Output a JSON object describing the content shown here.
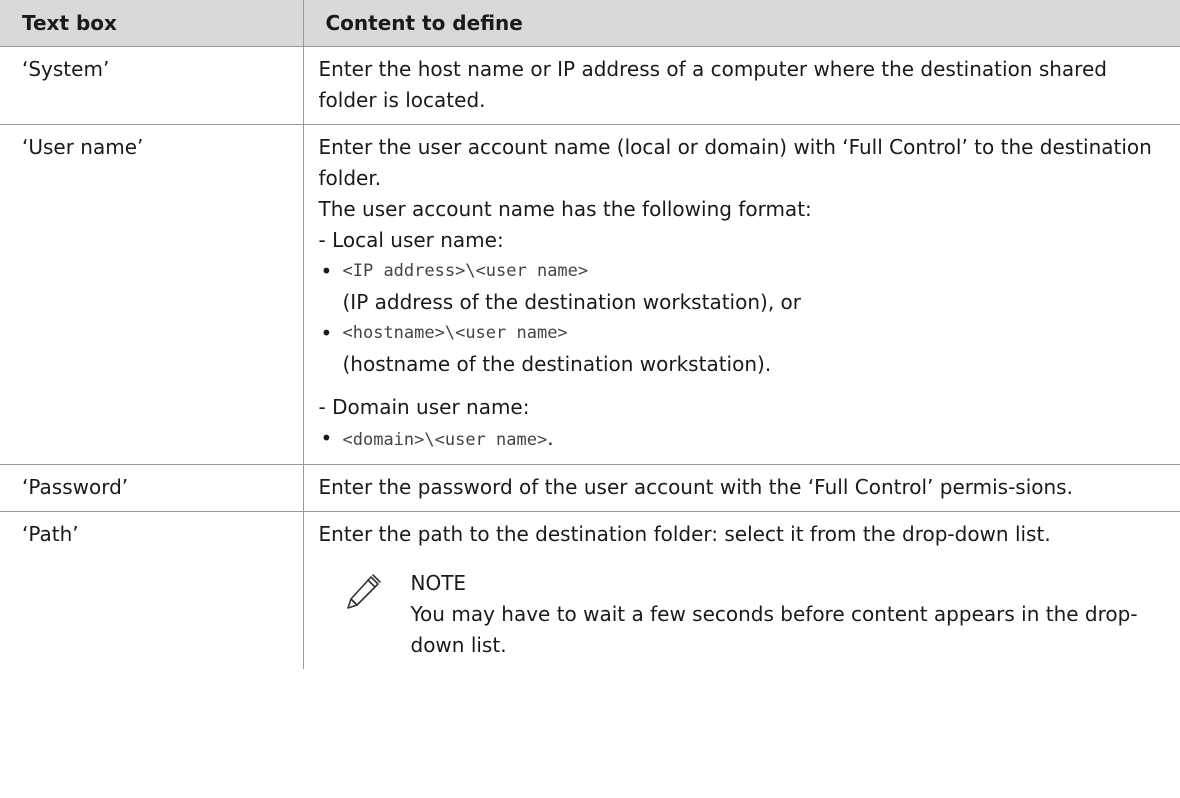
{
  "table": {
    "headers": [
      "Text box",
      "Content to define"
    ],
    "rows": [
      {
        "label": "‘System’",
        "lines": [
          "Enter the host name or IP address of a computer where the destination shared folder is located."
        ]
      },
      {
        "label": "‘User name’",
        "intro": [
          "Enter the user account name (local or domain) with ‘Full Control’ to the destination folder.",
          "The user account name has the following format:",
          "- Local user name:"
        ],
        "local_items": [
          {
            "code": "<IP address>\\<user name>",
            "desc": "(IP address of the destination workstation), or"
          },
          {
            "code": "<hostname>\\<user name>",
            "desc": "(hostname of the destination workstation)."
          }
        ],
        "domain_label": "- Domain user name:",
        "domain_items": [
          {
            "code": "<domain>\\<user name>",
            "suffix": "."
          }
        ]
      },
      {
        "label": "‘Password’",
        "lines": [
          "Enter the password of the user account with the ‘Full Control’ permis-sions."
        ]
      },
      {
        "label": "‘Path’",
        "lines": [
          "Enter the path to the destination folder: select it from the drop-down list."
        ],
        "note": {
          "icon": "pencil-icon",
          "title": "NOTE",
          "text": "You may have to wait a few seconds before content appears in the drop-down list."
        }
      }
    ]
  },
  "bullet_char": "•"
}
